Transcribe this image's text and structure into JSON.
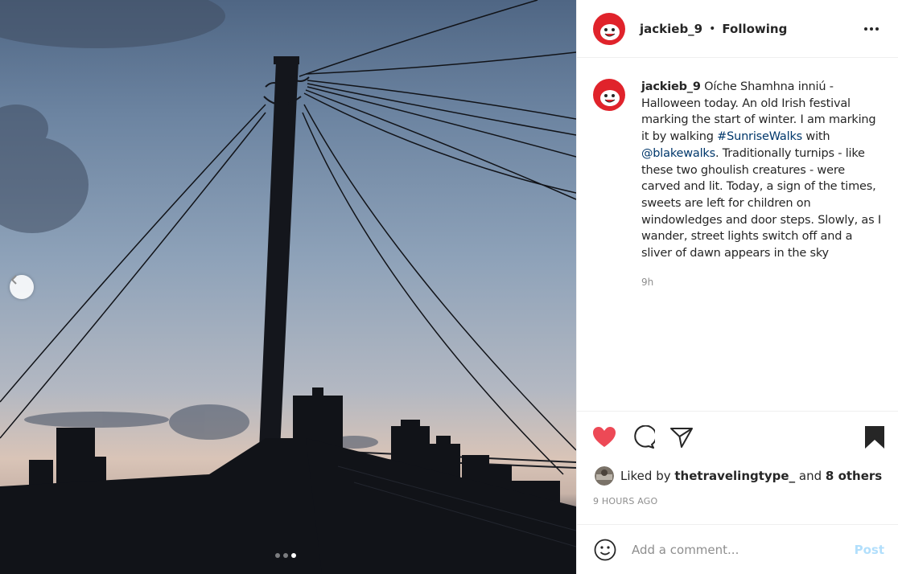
{
  "post": {
    "username": "jackieb_9",
    "bullet": "•",
    "follow_status": "Following",
    "caption": {
      "author": "jackieb_9",
      "text_before": " Oíche Shamhna inniú - Halloween today. An old Irish festival marking the start of winter. I am marking it by walking ",
      "hashtag": "#SunriseWalks",
      "text_mid": " with ",
      "mention": "@blakewalks",
      "text_after": ". Traditionally turnips - like these two ghoulish creatures - were carved and lit. Today, a sign of the times, sweets are left for children on windowledges and door steps. Slowly, as I wander, street lights switch off and a sliver of dawn appears in the sky"
    },
    "caption_time": "9h",
    "likes": {
      "prefix": "Liked by",
      "user": "thetravelingtype_",
      "middle": "and",
      "others": "8 others"
    },
    "timestamp": "9 HOURS AGO",
    "comment_placeholder": "Add a comment...",
    "post_label": "Post",
    "carousel": {
      "total": 3,
      "active_index": 3
    }
  },
  "icons": {
    "more": "more-options-icon",
    "like": "heart-filled-icon",
    "comment": "comment-bubble-icon",
    "share": "paper-plane-icon",
    "save": "bookmark-filled-icon",
    "emoji": "emoji-smiley-icon",
    "prev": "chevron-left-icon"
  },
  "colors": {
    "like_red": "#ed4956",
    "link_blue": "#00376b",
    "post_button_disabled": "#b2dffc",
    "secondary_text": "#8e8e8e",
    "avatar_red": "#e0232b"
  }
}
